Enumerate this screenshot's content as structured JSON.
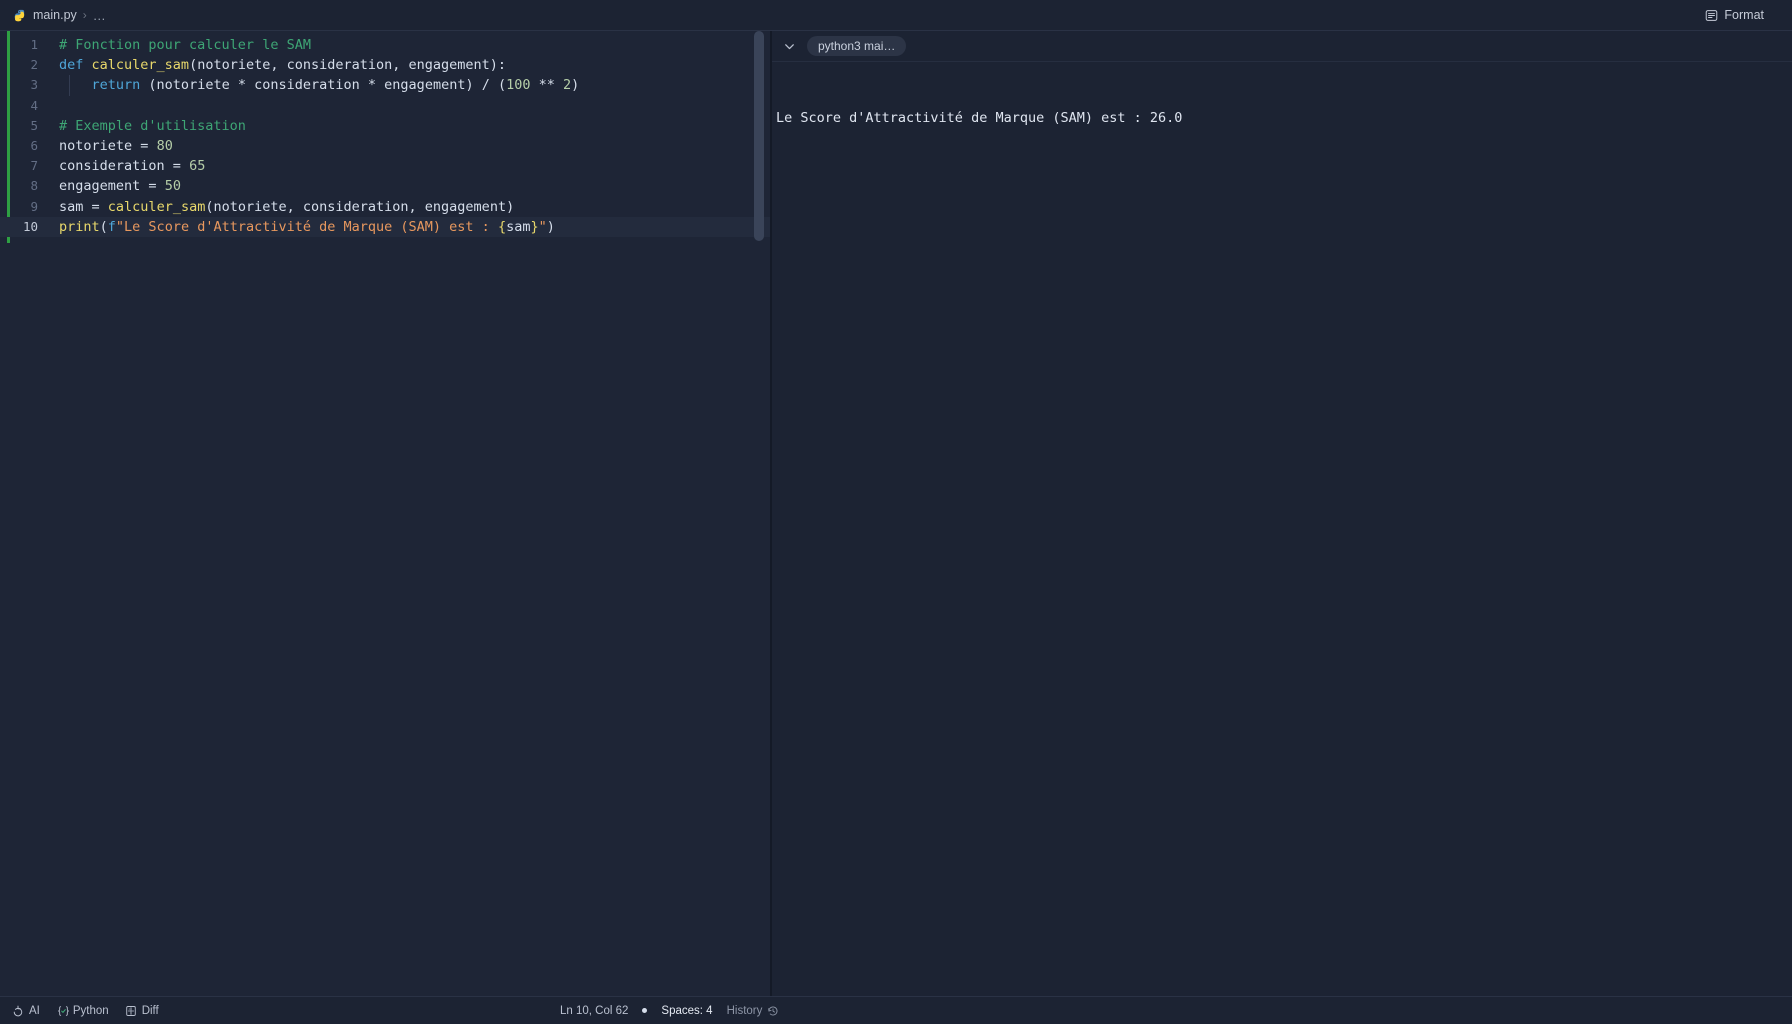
{
  "window": {
    "title": "main.py"
  },
  "breadcrumb": {
    "file_icon": "python-icon",
    "file": "main.py",
    "separator": "›",
    "ellipsis": "…"
  },
  "toolbar": {
    "format_label": "Format",
    "format_icon": "format-document-icon"
  },
  "editor": {
    "language": "Python",
    "indent": "Spaces: 4",
    "active_line": 10,
    "lines": [
      {
        "number": "1",
        "tokens": [
          {
            "t": "# Fonction pour calculer le SAM",
            "c": "t-com"
          }
        ]
      },
      {
        "number": "2",
        "tokens": [
          {
            "t": "def ",
            "c": "t-kw"
          },
          {
            "t": "calculer_sam",
            "c": "t-fn"
          },
          {
            "t": "(notoriete, consideration, engagement):",
            "c": "t-punc"
          }
        ]
      },
      {
        "number": "3",
        "tokens": [
          {
            "t": "    ",
            "c": "t-punc"
          },
          {
            "t": "return",
            "c": "t-kw"
          },
          {
            "t": " (notoriete ",
            "c": "t-punc"
          },
          {
            "t": "*",
            "c": "t-op"
          },
          {
            "t": " consideration ",
            "c": "t-punc"
          },
          {
            "t": "*",
            "c": "t-op"
          },
          {
            "t": " engagement) ",
            "c": "t-punc"
          },
          {
            "t": "/",
            "c": "t-op"
          },
          {
            "t": " (",
            "c": "t-punc"
          },
          {
            "t": "100",
            "c": "t-num"
          },
          {
            "t": " ** ",
            "c": "t-op"
          },
          {
            "t": "2",
            "c": "t-num"
          },
          {
            "t": ")",
            "c": "t-punc"
          }
        ]
      },
      {
        "number": "4",
        "tokens": []
      },
      {
        "number": "5",
        "tokens": [
          {
            "t": "# Exemple d'utilisation",
            "c": "t-com"
          }
        ]
      },
      {
        "number": "6",
        "tokens": [
          {
            "t": "notoriete ",
            "c": "t-var"
          },
          {
            "t": "=",
            "c": "t-op"
          },
          {
            "t": " ",
            "c": "t-punc"
          },
          {
            "t": "80",
            "c": "t-num"
          }
        ]
      },
      {
        "number": "7",
        "tokens": [
          {
            "t": "consideration ",
            "c": "t-var"
          },
          {
            "t": "=",
            "c": "t-op"
          },
          {
            "t": " ",
            "c": "t-punc"
          },
          {
            "t": "65",
            "c": "t-num"
          }
        ]
      },
      {
        "number": "8",
        "tokens": [
          {
            "t": "engagement ",
            "c": "t-var"
          },
          {
            "t": "=",
            "c": "t-op"
          },
          {
            "t": " ",
            "c": "t-punc"
          },
          {
            "t": "50",
            "c": "t-num"
          }
        ]
      },
      {
        "number": "9",
        "tokens": [
          {
            "t": "sam ",
            "c": "t-var"
          },
          {
            "t": "=",
            "c": "t-op"
          },
          {
            "t": " ",
            "c": "t-punc"
          },
          {
            "t": "calculer_sam",
            "c": "t-fn"
          },
          {
            "t": "(notoriete, consideration, engagement)",
            "c": "t-punc"
          }
        ]
      },
      {
        "number": "10",
        "tokens": [
          {
            "t": "print",
            "c": "t-fn"
          },
          {
            "t": "(",
            "c": "t-punc"
          },
          {
            "t": "f",
            "c": "t-kw"
          },
          {
            "t": "\"Le Score d'Attractivité de Marque (SAM) est : ",
            "c": "t-str"
          },
          {
            "t": "{",
            "c": "t-fstr-brace"
          },
          {
            "t": "sam",
            "c": "t-interp"
          },
          {
            "t": "}",
            "c": "t-fstr-brace"
          },
          {
            "t": "\"",
            "c": "t-str"
          },
          {
            "t": ")",
            "c": "t-punc"
          }
        ]
      }
    ]
  },
  "console": {
    "collapse_icon": "chevron-down-icon",
    "run_label": "python3 mai…",
    "output": "Le Score d'Attractivité de Marque (SAM) est : 26.0"
  },
  "statusbar": {
    "ai_icon": "ai-sparkle-icon",
    "ai_label": "AI",
    "language_icon": "braces-check-icon",
    "language_label": "Python",
    "diff_icon": "diff-icon",
    "diff_label": "Diff",
    "cursor_position": "Ln 10, Col 62",
    "indent_label": "Spaces: 4",
    "history_label": "History",
    "history_icon": "history-clock-icon"
  },
  "colors": {
    "background": "#1c2333",
    "editor_background": "#1e2536",
    "active_line": "#232b3d",
    "git_added": "#2ea043",
    "comment": "#3ea675",
    "keyword": "#4fa6d8",
    "function": "#e8d86b",
    "number": "#b5cea8",
    "string": "#e8985e",
    "text": "#d6deeb"
  }
}
